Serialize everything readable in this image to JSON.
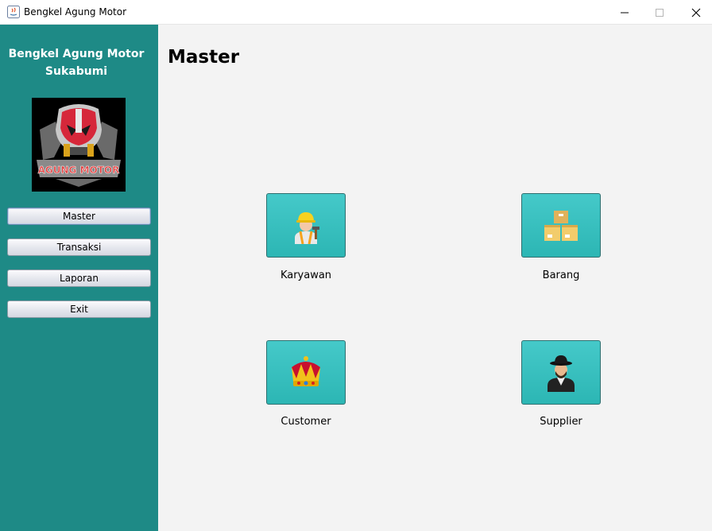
{
  "window": {
    "title": "Bengkel Agung Motor"
  },
  "sidebar": {
    "brand_line1": "Bengkel Agung Motor",
    "brand_line2": "Sukabumi",
    "logo_text": "AGUNG MOTOR",
    "nav": [
      {
        "label": "Master",
        "active": true
      },
      {
        "label": "Transaksi"
      },
      {
        "label": "Laporan"
      },
      {
        "label": "Exit"
      }
    ]
  },
  "main": {
    "title": "Master",
    "tiles": [
      {
        "label": "Karyawan",
        "icon": "worker-icon"
      },
      {
        "label": "Barang",
        "icon": "boxes-icon"
      },
      {
        "label": "Customer",
        "icon": "crown-icon"
      },
      {
        "label": "Supplier",
        "icon": "man-hat-icon"
      }
    ]
  },
  "colors": {
    "sidebar_bg": "#1e8a86",
    "tile_bg": "#36bfbe",
    "main_bg": "#f3f3f3"
  }
}
